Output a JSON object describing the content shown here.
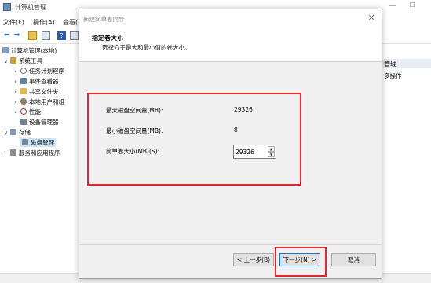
{
  "background_window": {
    "title": "计算机管理",
    "menu": [
      "文件(F)",
      "操作(A)",
      "查看("
    ],
    "tree": [
      {
        "label": "计算机管理(本地)",
        "icon": "computer-icon"
      },
      {
        "label": "系统工具",
        "icon": "tools-icon"
      },
      {
        "label": "任务计划程序",
        "icon": "clock-icon"
      },
      {
        "label": "事件查看器",
        "icon": "event-viewer-icon"
      },
      {
        "label": "共享文件夹",
        "icon": "shared-folder-icon"
      },
      {
        "label": "本地用户和组",
        "icon": "users-icon"
      },
      {
        "label": "性能",
        "icon": "performance-icon"
      },
      {
        "label": "设备管理器",
        "icon": "device-manager-icon"
      },
      {
        "label": "存储",
        "icon": "storage-icon"
      },
      {
        "label": "磁盘管理",
        "icon": "disk-icon"
      },
      {
        "label": "服务和应用程序",
        "icon": "services-icon"
      }
    ],
    "actions_header": "管理",
    "actions_more": "多操作"
  },
  "wizard": {
    "title": "新建简单卷向导",
    "heading": "指定卷大小",
    "subheading": "选择介于最大和最小值的卷大小。",
    "max_label": "最大磁盘空间量(MB):",
    "max_value": "29326",
    "min_label": "最小磁盘空间量(MB):",
    "min_value": "8",
    "size_label": "简单卷大小(MB)(S):",
    "size_value": "29326",
    "buttons": {
      "back": "< 上一步(B)",
      "next": "下一步(N) >",
      "cancel": "取消"
    }
  },
  "colors": {
    "highlight": "#e3242b",
    "dialog_bg": "#f0f0f0"
  }
}
